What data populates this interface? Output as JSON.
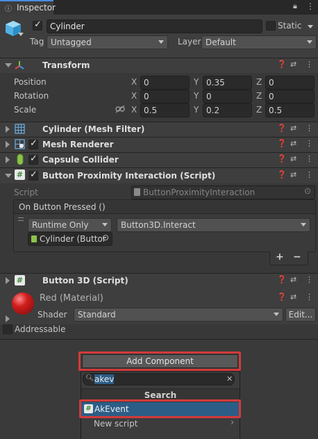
{
  "tab": {
    "label": "Inspector"
  },
  "object": {
    "name": "Cylinder",
    "static_label": "Static",
    "tag_label": "Tag",
    "tag_value": "Untagged",
    "layer_label": "Layer",
    "layer_value": "Default"
  },
  "transform": {
    "title": "Transform",
    "position": {
      "label": "Position",
      "x": "0",
      "y": "0.35",
      "z": "0"
    },
    "rotation": {
      "label": "Rotation",
      "x": "0",
      "y": "0",
      "z": "0"
    },
    "scale": {
      "label": "Scale",
      "x": "0.5",
      "y": "0.2",
      "z": "0.5"
    },
    "axis": {
      "x": "X",
      "y": "Y",
      "z": "Z"
    }
  },
  "components": {
    "mesh_filter": "Cylinder (Mesh Filter)",
    "mesh_renderer": "Mesh Renderer",
    "capsule_collider": "Capsule Collider",
    "proximity": "Button Proximity Interaction (Script)",
    "button3d": "Button 3D (Script)"
  },
  "script_field": {
    "label": "Script",
    "value": "ButtonProximityInteraction"
  },
  "event": {
    "title": "On Button Pressed ()",
    "runtime": "Runtime Only",
    "function": "Button3D.Interact",
    "target": "Cylinder (Buttor",
    "plus": "+",
    "minus": "−"
  },
  "material": {
    "name": "Red (Material)",
    "shader_label": "Shader",
    "shader_value": "Standard",
    "edit_label": "Edit..."
  },
  "addressable_label": "Addressable",
  "add_component": {
    "label": "Add Component",
    "search_value": "akev",
    "search_header": "Search",
    "result": "AkEvent",
    "new_script": "New script"
  },
  "colors": {
    "highlight": "#d33a3a",
    "selected": "#2c5d87"
  }
}
